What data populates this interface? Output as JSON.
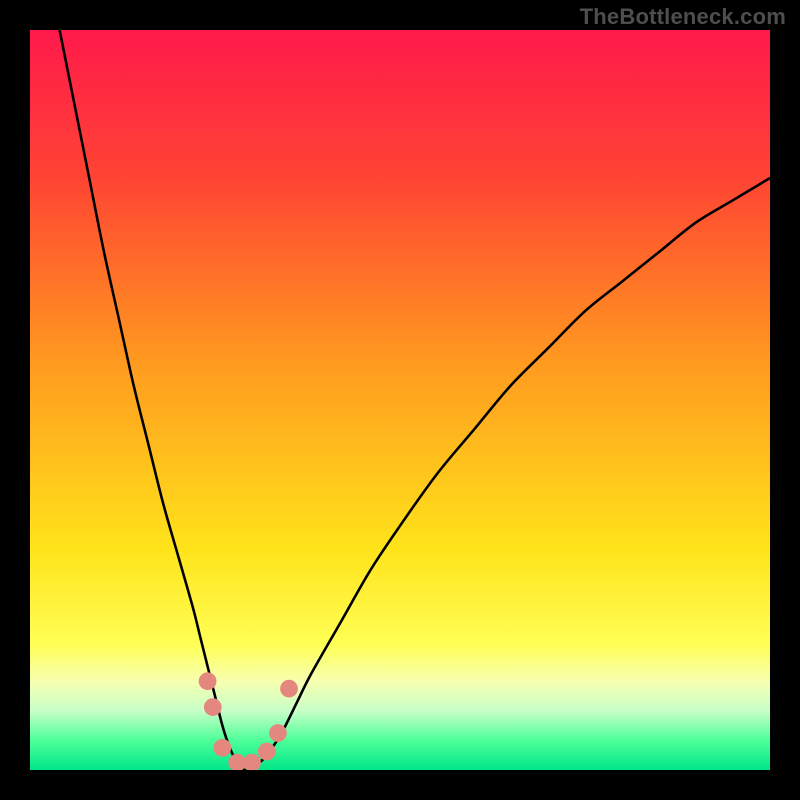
{
  "watermark": "TheBottleneck.com",
  "chart_data": {
    "type": "line",
    "title": "",
    "xlabel": "",
    "ylabel": "",
    "xlim": [
      0,
      100
    ],
    "ylim": [
      0,
      100
    ],
    "background_gradient_stops": [
      {
        "offset": 0.0,
        "color": "#ff1a4b"
      },
      {
        "offset": 0.2,
        "color": "#ff4433"
      },
      {
        "offset": 0.45,
        "color": "#ff9a1f"
      },
      {
        "offset": 0.7,
        "color": "#ffe31a"
      },
      {
        "offset": 0.83,
        "color": "#ffff55"
      },
      {
        "offset": 0.88,
        "color": "#f7ffb0"
      },
      {
        "offset": 0.92,
        "color": "#c8ffc8"
      },
      {
        "offset": 0.96,
        "color": "#4dff99"
      },
      {
        "offset": 1.0,
        "color": "#00e68a"
      }
    ],
    "series": [
      {
        "name": "bottleneck-curve",
        "color": "#000000",
        "x": [
          4,
          6,
          8,
          10,
          12,
          14,
          16,
          18,
          20,
          22,
          23,
          24,
          25,
          26,
          27,
          28,
          29,
          30,
          31,
          32,
          34,
          36,
          38,
          42,
          46,
          50,
          55,
          60,
          65,
          70,
          75,
          80,
          85,
          90,
          95,
          100
        ],
        "values": [
          100,
          90,
          80,
          70,
          61,
          52,
          44,
          36,
          29,
          22,
          18,
          14,
          10,
          6,
          3,
          1,
          0,
          0,
          1,
          2,
          5,
          9,
          13,
          20,
          27,
          33,
          40,
          46,
          52,
          57,
          62,
          66,
          70,
          74,
          77,
          80
        ]
      }
    ],
    "markers": {
      "name": "highlight-points",
      "color": "#e4887f",
      "radius_pct": 1.2,
      "points": [
        {
          "x": 24.0,
          "y": 12.0
        },
        {
          "x": 24.7,
          "y": 8.5
        },
        {
          "x": 26.0,
          "y": 3.0
        },
        {
          "x": 28.0,
          "y": 1.0
        },
        {
          "x": 30.0,
          "y": 1.0
        },
        {
          "x": 32.0,
          "y": 2.5
        },
        {
          "x": 33.5,
          "y": 5.0
        },
        {
          "x": 35.0,
          "y": 11.0
        }
      ]
    }
  }
}
